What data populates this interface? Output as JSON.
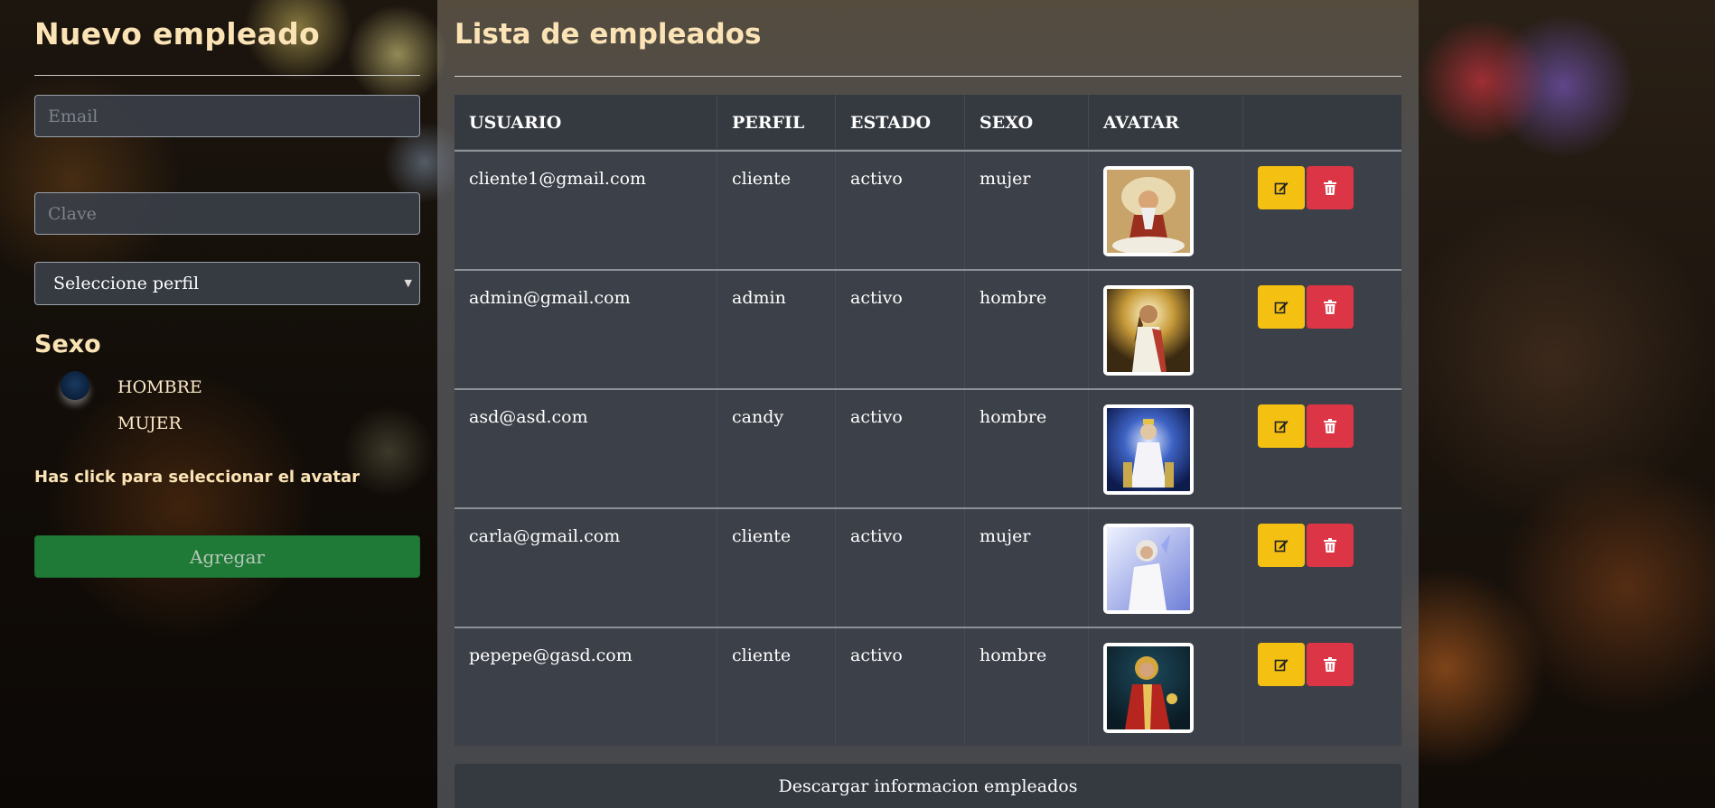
{
  "form": {
    "title": "Nuevo empleado",
    "email_placeholder": "Email",
    "clave_placeholder": "Clave",
    "perfil_select": "Seleccione perfil",
    "sexo_label": "Sexo",
    "sexo_options": [
      "HOMBRE",
      "MUJER"
    ],
    "avatar_hint": "Has click para seleccionar el avatar",
    "submit_label": "Agregar"
  },
  "list": {
    "title": "Lista de empleados",
    "columns": [
      "USUARIO",
      "PERFIL",
      "ESTADO",
      "SEXO",
      "AVATAR",
      ""
    ],
    "rows": [
      {
        "usuario": "cliente1@gmail.com",
        "perfil": "cliente",
        "estado": "activo",
        "sexo": "mujer"
      },
      {
        "usuario": "admin@gmail.com",
        "perfil": "admin",
        "estado": "activo",
        "sexo": "hombre"
      },
      {
        "usuario": "asd@asd.com",
        "perfil": "candy",
        "estado": "activo",
        "sexo": "hombre"
      },
      {
        "usuario": "carla@gmail.com",
        "perfil": "cliente",
        "estado": "activo",
        "sexo": "mujer"
      },
      {
        "usuario": "pepepe@gasd.com",
        "perfil": "cliente",
        "estado": "activo",
        "sexo": "hombre"
      }
    ],
    "row_actions": {
      "edit_icon": "edit-icon",
      "delete_icon": "trash-icon"
    },
    "download_label": "Descargar informacion empleados"
  },
  "colors": {
    "heading": "#fbe3b5",
    "edit_button": "#f4c012",
    "delete_button": "#dc3545",
    "submit_button": "#207a37"
  }
}
